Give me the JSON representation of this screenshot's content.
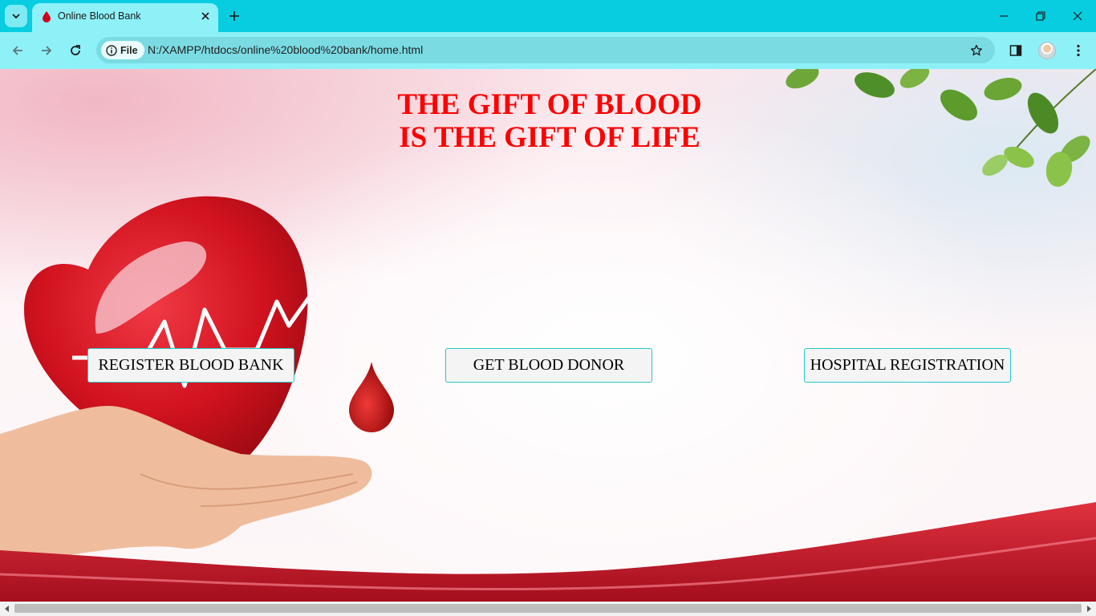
{
  "browser": {
    "tab_title": "Online Blood Bank",
    "site_chip_label": "File",
    "url": "N:/XAMPP/htdocs/online%20blood%20bank/home.html"
  },
  "page": {
    "headline_line1": "THE GIFT OF BLOOD",
    "headline_line2": "IS THE GIFT OF LIFE",
    "buttons": {
      "register_blood_bank": "REGISTER BLOOD BANK",
      "get_blood_donor": "GET BLOOD DONOR",
      "hospital_registration": "HOSPITAL REGISTRATION"
    }
  },
  "colors": {
    "chrome_accent": "#08cde0",
    "headline": "#ff0000",
    "button_border": "#26c6c6",
    "blood_red": "#c8102e"
  }
}
